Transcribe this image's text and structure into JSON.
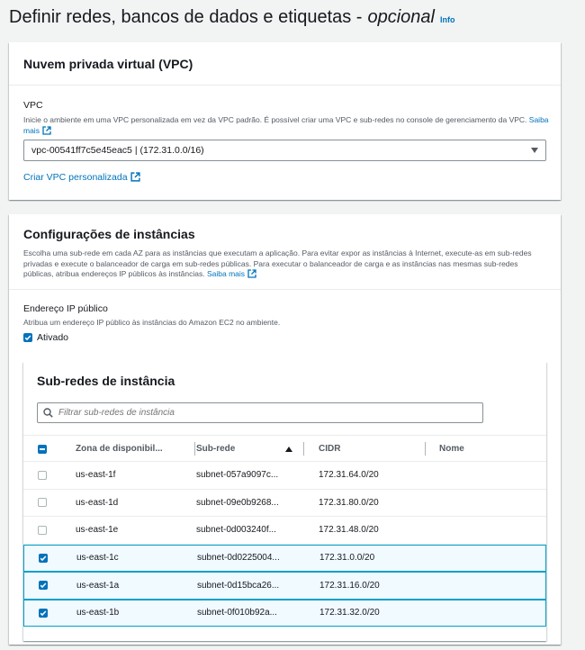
{
  "page": {
    "title": "Definir redes, bancos de dados e etiquetas - ",
    "title_optional": "opcional",
    "info_link": "Info"
  },
  "vpc_panel": {
    "heading": "Nuvem privada virtual (VPC)",
    "field_label": "VPC",
    "description": "Inicie o ambiente em uma VPC personalizada em vez da VPC padrão. É possível criar uma VPC e sub-redes no console de gerenciamento da VPC.",
    "learn_more": "Saiba mais",
    "selected_vpc": "vpc-00541ff7c5e45eac5 | (172.31.0.0/16)",
    "create_link": "Criar VPC personalizada"
  },
  "instance_panel": {
    "heading": "Configurações de instâncias",
    "description": "Escolha uma sub-rede em cada AZ para as instâncias que executam a aplicação. Para evitar expor as instâncias à Internet, execute-as em sub-redes privadas e execute o balanceador de carga em sub-redes públicas. Para executar o balanceador de carga e as instâncias nas mesmas sub-redes públicas, atribua endereços IP públicos às instâncias.",
    "learn_more": "Saiba mais",
    "public_ip_label": "Endereço IP público",
    "public_ip_description": "Atribua um endereço IP público às instâncias do Amazon EC2 no ambiente.",
    "public_ip_checkbox": "Ativado",
    "public_ip_checked": true
  },
  "subnets": {
    "heading": "Sub-redes de instância",
    "filter_placeholder": "Filtrar sub-redes de instância",
    "columns": [
      "Zona de disponibil...",
      "Sub-rede",
      "CIDR",
      "Nome"
    ],
    "sorted_column": "Sub-rede",
    "rows": [
      {
        "zone": "us-east-1f",
        "subnet": "subnet-057a9097c...",
        "cidr": "172.31.64.0/20",
        "name": "",
        "selected": false
      },
      {
        "zone": "us-east-1d",
        "subnet": "subnet-09e0b9268...",
        "cidr": "172.31.80.0/20",
        "name": "",
        "selected": false
      },
      {
        "zone": "us-east-1e",
        "subnet": "subnet-0d003240f...",
        "cidr": "172.31.48.0/20",
        "name": "",
        "selected": false
      },
      {
        "zone": "us-east-1c",
        "subnet": "subnet-0d0225004...",
        "cidr": "172.31.0.0/20",
        "name": "",
        "selected": true
      },
      {
        "zone": "us-east-1a",
        "subnet": "subnet-0d15bca26...",
        "cidr": "172.31.16.0/20",
        "name": "",
        "selected": true
      },
      {
        "zone": "us-east-1b",
        "subnet": "subnet-0f010b92a...",
        "cidr": "172.31.32.0/20",
        "name": "",
        "selected": true
      }
    ]
  },
  "colors": {
    "link": "#0073bb",
    "selected_row_bg": "#f1faff",
    "selected_row_border": "#00a1c9"
  }
}
